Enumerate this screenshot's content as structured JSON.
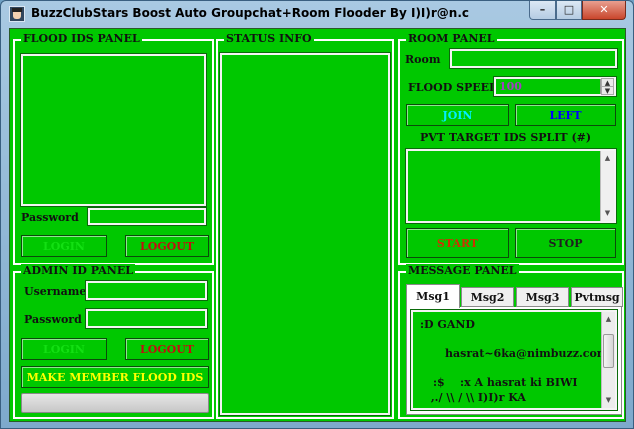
{
  "window": {
    "title": "BuzzClubStars Boost Auto Groupchat+Room Flooder By I)I)r@n.c",
    "min_glyph": "–",
    "max_glyph": "□",
    "close_glyph": "✕"
  },
  "colors": {
    "panel_bg": "#00c800",
    "login_text": "#13e013",
    "logout_text": "#c01010",
    "join_text": "#00f0ff",
    "left_text": "#0000ff",
    "start_text": "#cc3300",
    "stop_text": "#1f1f1f",
    "make_member_text": "#ffff00",
    "speed_text": "#a040c0"
  },
  "flood_panel": {
    "title": "FLOOD IDS PANEL",
    "password_label": "Password",
    "password_value": "",
    "login_label": "LOGIN",
    "logout_label": "LOGOUT"
  },
  "status_panel": {
    "title": "STATUS INFO"
  },
  "admin_panel": {
    "title": "ADMIN ID PANEL",
    "username_label": "Username",
    "username_value": "",
    "password_label": "Password",
    "password_value": "",
    "login_label": "LOGIN",
    "logout_label": "LOGOUT",
    "make_member_label": "MAKE MEMBER FLOOD IDS",
    "progress_value": 0
  },
  "room_panel": {
    "title": "ROOM PANEL",
    "room_label": "Room",
    "room_value": "",
    "flood_speed_label": "FLOOD SPEED",
    "flood_speed_value": "100",
    "join_label": "JOIN",
    "left_label": "LEFT",
    "pvt_label": "PVT TARGET IDS SPLIT (#)",
    "start_label": "START",
    "stop_label": "STOP"
  },
  "message_panel": {
    "title": "MESSAGE PANEL",
    "tabs": [
      {
        "label": "Msg1"
      },
      {
        "label": "Msg2"
      },
      {
        "label": "Msg3"
      },
      {
        "label": "Pvtmsg"
      }
    ],
    "active_tab": "Msg1",
    "lines": [
      ":D GAND",
      "hasrat~6ka@nimbuzz.com",
      ":$    :x A hasrat ki BIWI",
      " ,./ \\\\ / \\\\ I)I)r KA"
    ]
  }
}
